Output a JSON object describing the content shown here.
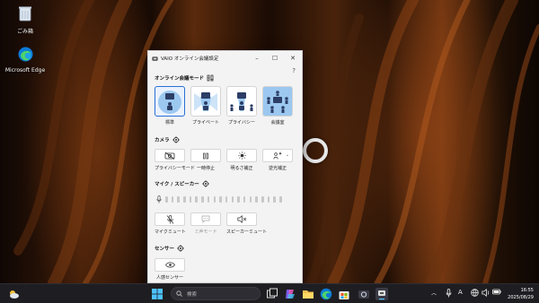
{
  "desktop": {
    "icons": [
      {
        "label": "ごみ箱"
      },
      {
        "label": "Microsoft Edge"
      }
    ]
  },
  "window": {
    "title": "VAIO オンライン会議設定",
    "help": "?",
    "mode_section": {
      "title": "オンライン会議モード",
      "modes": [
        {
          "label": "標準",
          "selected": true
        },
        {
          "label": "プライベート",
          "selected": false
        },
        {
          "label": "プライバシー",
          "selected": false
        },
        {
          "label": "会議室",
          "selected": false
        }
      ]
    },
    "camera_section": {
      "title": "カメラ",
      "buttons": [
        {
          "label": "プライバシーモード",
          "icon": "camera-off-icon"
        },
        {
          "label": "一時停止",
          "icon": "pause-icon"
        },
        {
          "label": "明るさ補正",
          "icon": "brightness-icon"
        },
        {
          "label": "逆光補正",
          "icon": "backlight-icon"
        }
      ]
    },
    "mic_section": {
      "title": "マイク / スピーカー",
      "level_segments": 20,
      "buttons": [
        {
          "label": "マイクミュート",
          "icon": "mic-mute-icon",
          "enabled": true
        },
        {
          "label": "ミ声モード",
          "icon": "chat-icon",
          "enabled": false
        },
        {
          "label": "スピーカーミュート",
          "icon": "speaker-mute-icon",
          "enabled": true
        }
      ]
    },
    "sensor_section": {
      "title": "センサー",
      "buttons": [
        {
          "label": "人感センサー",
          "icon": "eye-icon"
        }
      ]
    }
  },
  "taskbar": {
    "search_placeholder": "検索",
    "ime": "A",
    "clock": {
      "time": "16:55",
      "date": "2025/08/29"
    }
  },
  "colors": {
    "accent": "#2a6fd6",
    "window_bg": "#f3f3f3",
    "taskbar_bg": "#1e1e22"
  }
}
